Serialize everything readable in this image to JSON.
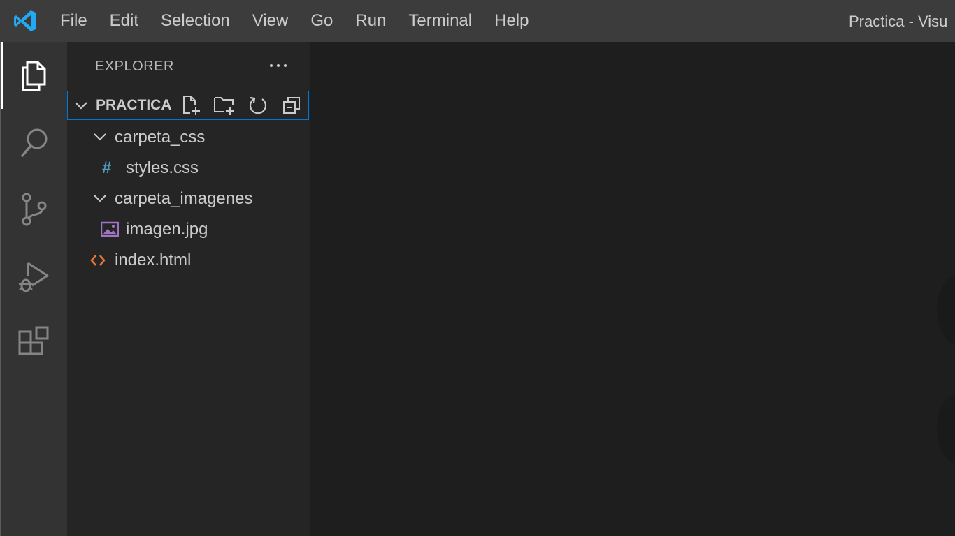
{
  "titlebar": {
    "menu": [
      "File",
      "Edit",
      "Selection",
      "View",
      "Go",
      "Run",
      "Terminal",
      "Help"
    ],
    "window_title": "Practica - Visu",
    "logo_icon": "vscode-logo-icon",
    "bg_color": "#3c3c3c"
  },
  "activitybar": {
    "items": [
      {
        "name": "explorer",
        "icon": "files-icon",
        "active": true
      },
      {
        "name": "search",
        "icon": "search-icon",
        "active": false
      },
      {
        "name": "source-control",
        "icon": "source-control-icon",
        "active": false
      },
      {
        "name": "run-and-debug",
        "icon": "run-debug-icon",
        "active": false
      },
      {
        "name": "extensions",
        "icon": "extensions-icon",
        "active": false
      }
    ]
  },
  "sidebar": {
    "title": "EXPLORER",
    "more_icon": "ellipsis-icon",
    "folder": {
      "name": "PRACTICA",
      "actions": [
        {
          "name": "new-file",
          "icon": "new-file-icon"
        },
        {
          "name": "new-folder",
          "icon": "new-folder-icon"
        },
        {
          "name": "refresh",
          "icon": "refresh-icon"
        },
        {
          "name": "collapse-all",
          "icon": "collapse-all-icon"
        }
      ]
    },
    "tree": [
      {
        "label": "carpeta_css",
        "type": "folder",
        "expanded": true,
        "depth": 1
      },
      {
        "label": "styles.css",
        "type": "css",
        "icon_glyph": "#",
        "depth": 2
      },
      {
        "label": "carpeta_imagenes",
        "type": "folder",
        "expanded": true,
        "depth": 1
      },
      {
        "label": "imagen.jpg",
        "type": "image",
        "depth": 2
      },
      {
        "label": "index.html",
        "type": "html",
        "depth": 1
      }
    ]
  },
  "colors": {
    "accent": "#0078d4",
    "logo": "#23a9f2",
    "css_icon": "#519aba",
    "image_icon": "#a074c4",
    "html_icon": "#e37933"
  }
}
